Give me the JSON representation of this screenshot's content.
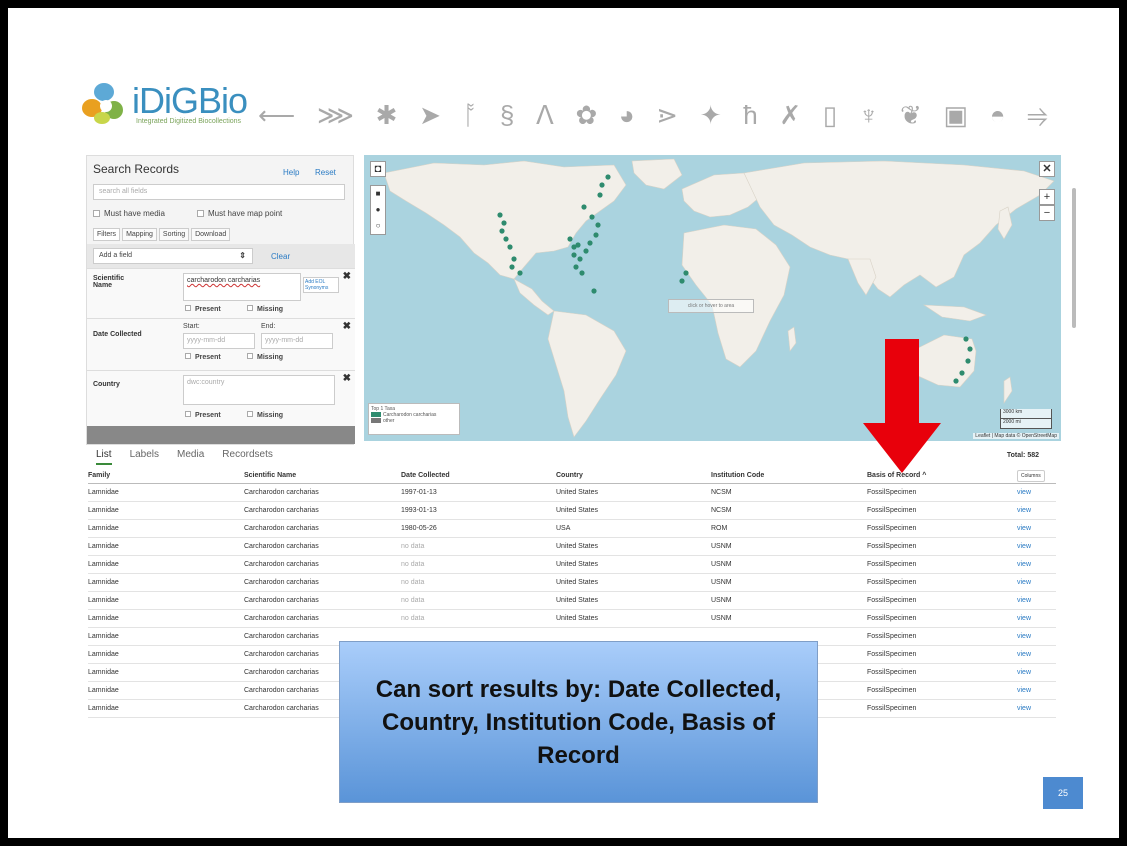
{
  "header": {
    "logo_text": "iDiGBio",
    "logo_tagline": "Integrated Digitized Biocollections",
    "silhouette_icons": [
      "fish-icon",
      "bat-icon",
      "crab-icon",
      "fish2-icon",
      "heron-icon",
      "dna-icon",
      "wolf-icon",
      "leaf-icon",
      "brain-icon",
      "fern-icon",
      "plant-icon",
      "giraffe-icon",
      "insect-icon",
      "phone-icon",
      "microscope-icon",
      "tree-icon",
      "camera-icon",
      "turtle-icon",
      "bird-icon"
    ]
  },
  "search": {
    "title": "Search Records",
    "help": "Help",
    "reset": "Reset",
    "placeholder": "search all fields",
    "must_have_media": "Must have media",
    "must_have_map": "Must have map point",
    "tabs": [
      "Filters",
      "Mapping",
      "Sorting",
      "Download"
    ],
    "add_field": "Add a field",
    "clear": "Clear",
    "filters": {
      "scientific_name": {
        "label": "Scientific Name",
        "value": "carcharodon carcharias",
        "add_syn": "Add EOL Synonyms",
        "present": "Present",
        "missing": "Missing"
      },
      "date_collected": {
        "label": "Date Collected",
        "start": "Start:",
        "end": "End:",
        "start_ph": "yyyy-mm-dd",
        "end_ph": "yyyy-mm-dd",
        "present": "Present",
        "missing": "Missing"
      },
      "country": {
        "label": "Country",
        "placeholder": "dwc:country",
        "present": "Present",
        "missing": "Missing"
      }
    }
  },
  "map": {
    "hint": "click or hover to area",
    "legend_title": "Top 1 Taxa",
    "legend_items": [
      "Carcharodon carcharias",
      "other"
    ],
    "legend_colors": [
      "#2e8b6e",
      "#777777"
    ],
    "scale_km": "3000 km",
    "scale_mi": "2000 mi",
    "attribution": "Leaflet | Map data © OpenStreetMap",
    "zoom_in": "+",
    "zoom_out": "−",
    "close": "✕"
  },
  "results": {
    "tabs": [
      "List",
      "Labels",
      "Media",
      "Recordsets"
    ],
    "total": "Total: 582",
    "columns": [
      "Family",
      "Scientific Name",
      "Date Collected",
      "Country",
      "Institution Code",
      "Basis of Record ^",
      "Columns"
    ],
    "rows": [
      [
        "Lamnidae",
        "Carcharodon carcharias",
        "1997-01-13",
        "United States",
        "NCSM",
        "FossilSpecimen",
        "view"
      ],
      [
        "Lamnidae",
        "Carcharodon carcharias",
        "1993-01-13",
        "United States",
        "NCSM",
        "FossilSpecimen",
        "view"
      ],
      [
        "Lamnidae",
        "Carcharodon carcharias",
        "1980-05-26",
        "USA",
        "ROM",
        "FossilSpecimen",
        "view"
      ],
      [
        "Lamnidae",
        "Carcharodon carcharias",
        "no data",
        "United States",
        "USNM",
        "FossilSpecimen",
        "view"
      ],
      [
        "Lamnidae",
        "Carcharodon carcharias",
        "no data",
        "United States",
        "USNM",
        "FossilSpecimen",
        "view"
      ],
      [
        "Lamnidae",
        "Carcharodon carcharias",
        "no data",
        "United States",
        "USNM",
        "FossilSpecimen",
        "view"
      ],
      [
        "Lamnidae",
        "Carcharodon carcharias",
        "no data",
        "United States",
        "USNM",
        "FossilSpecimen",
        "view"
      ],
      [
        "Lamnidae",
        "Carcharodon carcharias",
        "no data",
        "United States",
        "USNM",
        "FossilSpecimen",
        "view"
      ],
      [
        "Lamnidae",
        "Carcharodon carcharias",
        "",
        "",
        "",
        "FossilSpecimen",
        "view"
      ],
      [
        "Lamnidae",
        "Carcharodon carcharias",
        "",
        "",
        "",
        "FossilSpecimen",
        "view"
      ],
      [
        "Lamnidae",
        "Carcharodon carcharias",
        "",
        "",
        "",
        "FossilSpecimen",
        "view"
      ],
      [
        "Lamnidae",
        "Carcharodon carcharias",
        "",
        "",
        "",
        "FossilSpecimen",
        "view"
      ],
      [
        "Lamnidae",
        "Carcharodon carcharias",
        "",
        "",
        "",
        "FossilSpecimen",
        "view"
      ]
    ]
  },
  "callout": {
    "text": "Can sort results by: Date Collected, Country, Institution Code, Basis of Record",
    "arrow_color": "#e8000b"
  },
  "page_number": "25"
}
